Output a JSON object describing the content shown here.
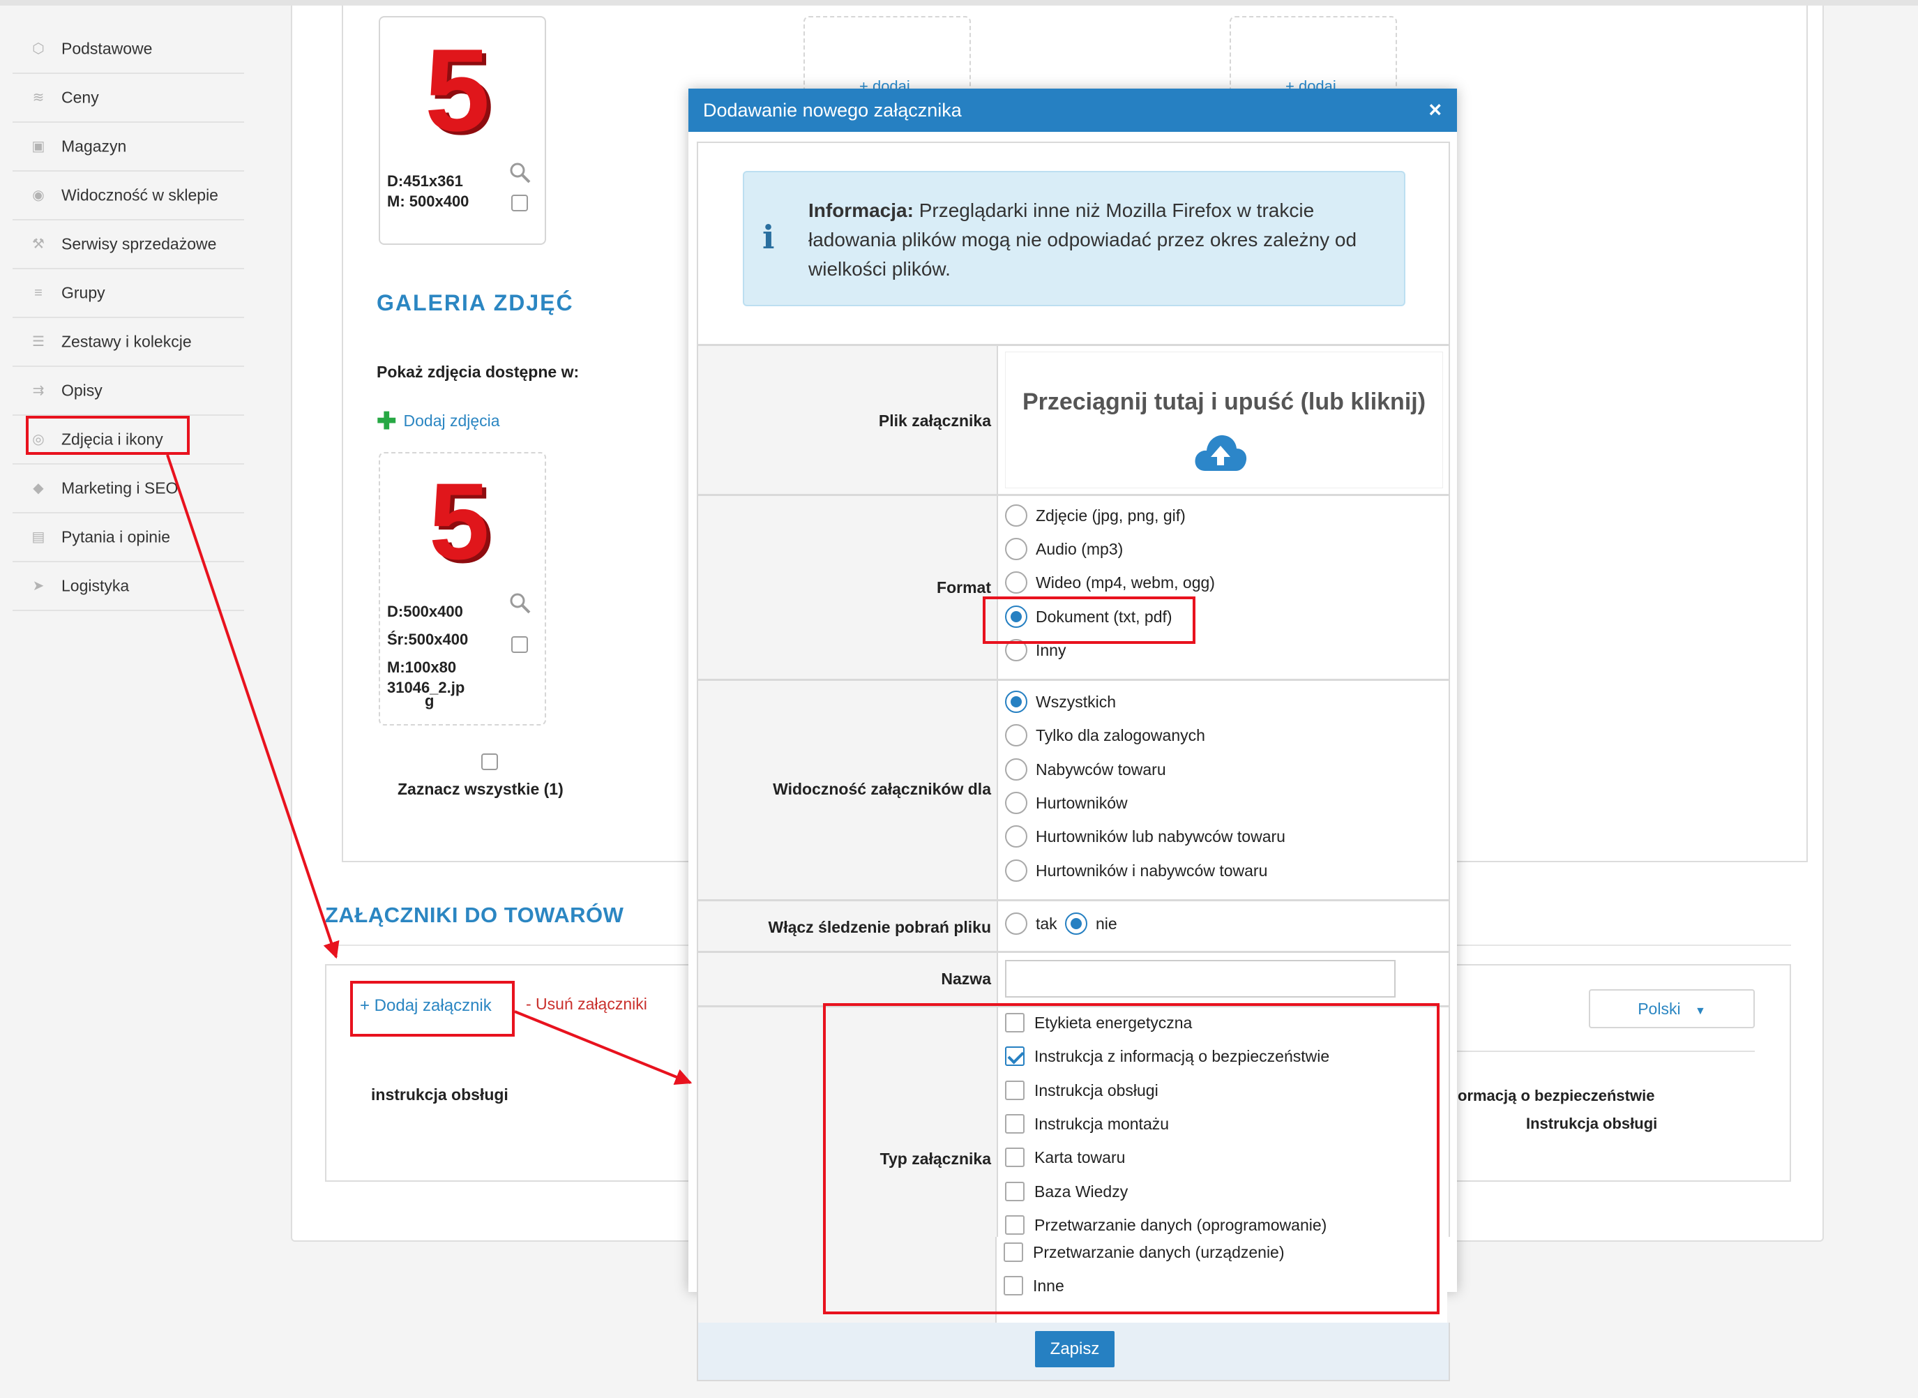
{
  "sidebar": {
    "items": [
      {
        "label": "Podstawowe",
        "icon": "cube-icon"
      },
      {
        "label": "Ceny",
        "icon": "coins-icon"
      },
      {
        "label": "Magazyn",
        "icon": "archive-icon"
      },
      {
        "label": "Widoczność w sklepie",
        "icon": "eye-icon"
      },
      {
        "label": "Serwisy sprzedażowe",
        "icon": "hammer-icon"
      },
      {
        "label": "Grupy",
        "icon": "layers-icon"
      },
      {
        "label": "Zestawy i kolekcje",
        "icon": "stack-icon"
      },
      {
        "label": "Opisy",
        "icon": "text-icon"
      },
      {
        "label": "Zdjęcia i ikony",
        "icon": "camera-icon"
      },
      {
        "label": "Marketing i SEO",
        "icon": "tag-icon"
      },
      {
        "label": "Pytania i opinie",
        "icon": "comment-icon"
      },
      {
        "label": "Logistyka",
        "icon": "send-icon"
      }
    ]
  },
  "gallery": {
    "thumb1": {
      "line1": "D:451x361",
      "line2": "M: 500x400"
    },
    "add_placeholder": "+ dodaj",
    "title": "GALERIA ZDJĘĆ",
    "show_label": "Pokaż zdjęcia dostępne w:",
    "add_photos": "Dodaj zdjęcia",
    "thumb2": {
      "line1": "D:500x400",
      "line2": "Śr:500x400",
      "line3": "M:100x80",
      "line4": "31046_2.jp",
      "line5": "g"
    },
    "select_all": "Zaznacz wszystkie (1)"
  },
  "attachments": {
    "title": "ZAŁĄCZNIKI DO TOWARÓW",
    "add_label": "+  Dodaj załącznik",
    "remove_label": "- Usuń załączniki",
    "row_name": "instrukcja obsługi",
    "partial_type": "ormacją o bezpieczeństwie",
    "partial_type2": "Instrukcja obsługi",
    "language": "Polski"
  },
  "modal": {
    "title": "Dodawanie nowego załącznika",
    "close": "×",
    "info_bold": "Informacja:",
    "info_text": " Przeglądarki inne niż Mozilla Firefox w trakcie ładowania plików mogą nie odpowiadać przez okres zależny od wielkości plików.",
    "file_label": "Plik załącznika",
    "dropzone_text": "Przeciągnij tutaj i upuść (lub kliknij)",
    "format_label": "Format",
    "format_options": [
      "Zdjęcie (jpg, png, gif)",
      "Audio (mp3)",
      "Wideo (mp4, webm, ogg)",
      "Dokument (txt, pdf)",
      "Inny"
    ],
    "format_selected": "Dokument (txt, pdf)",
    "visibility_label": "Widoczność załączników dla",
    "visibility_options": [
      "Wszystkich",
      "Tylko dla zalogowanych",
      "Nabywców towaru",
      "Hurtowników",
      "Hurtowników lub nabywców towaru",
      "Hurtowników i nabywców towaru"
    ],
    "visibility_selected": "Wszystkich",
    "tracking_label": "Włącz śledzenie pobrań pliku",
    "tracking_yes": "tak",
    "tracking_no": "nie",
    "tracking_selected": "nie",
    "name_label": "Nazwa",
    "name_value": "",
    "type_label": "Typ załącznika",
    "type_options": [
      "Etykieta energetyczna",
      "Instrukcja z informacją o bezpieczeństwie",
      "Instrukcja obsługi",
      "Instrukcja montażu",
      "Karta towaru",
      "Baza Wiedzy",
      "Przetwarzanie danych (oprogramowanie)",
      "Przetwarzanie danych (urządzenie)",
      "Inne"
    ],
    "type_checked": [
      "Instrukcja z informacją o bezpieczeństwie"
    ],
    "save": "Zapisz"
  },
  "colors": {
    "accent": "#2680c2",
    "highlight": "#e8121e",
    "add_green": "#27a844"
  }
}
